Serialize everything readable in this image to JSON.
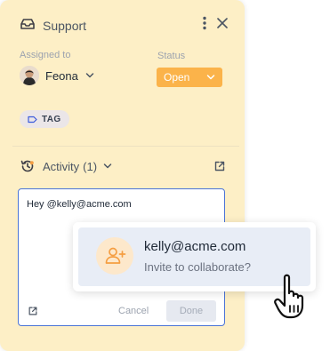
{
  "header": {
    "title": "Support",
    "icon": "inbox-icon"
  },
  "assigned": {
    "label": "Assigned to",
    "name": "Feona"
  },
  "status": {
    "label": "Status",
    "value": "Open"
  },
  "tag": {
    "label": "TAG"
  },
  "activity": {
    "label": "Activity",
    "count": "(1)"
  },
  "editor": {
    "text": "Hey @kelly@acme.com",
    "cancel_label": "Cancel",
    "done_label": "Done"
  },
  "mention_popup": {
    "email": "kelly@acme.com",
    "subtitle": "Invite to collaborate?"
  },
  "colors": {
    "panel_bg": "#fdefc6",
    "status_bg": "#fbb34a",
    "accent_blue": "#4b74d6",
    "invite_icon_bg": "#fde8cb",
    "invite_icon_fg": "#f59e42"
  }
}
